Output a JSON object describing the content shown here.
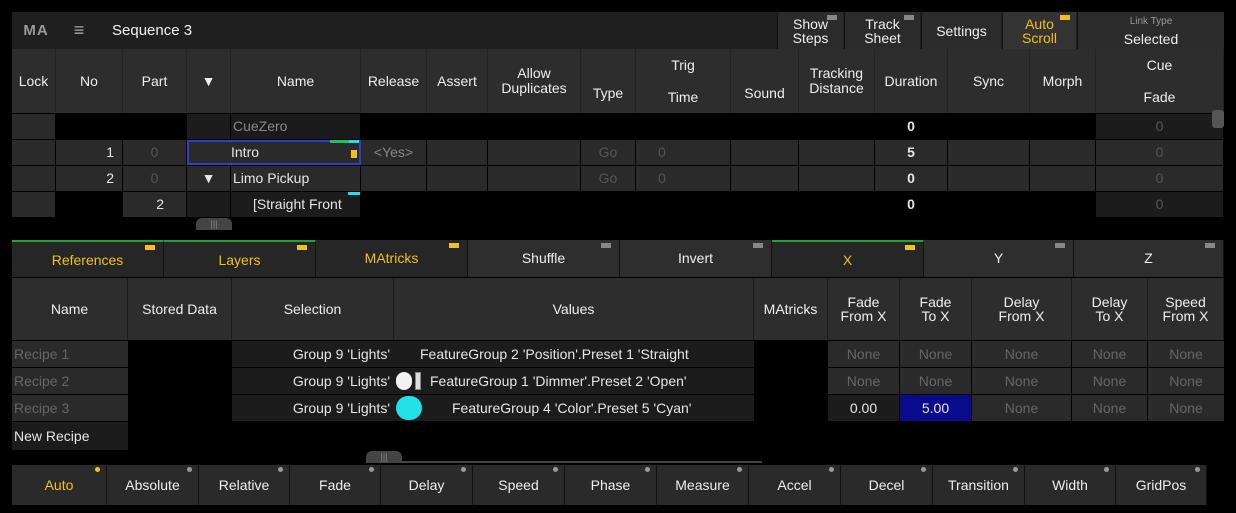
{
  "title_bar": {
    "logo": "MA",
    "menu_icon": "≡",
    "sequence": "Sequence 3",
    "buttons": [
      {
        "label": "Show Steps"
      },
      {
        "label": "Track Sheet"
      },
      {
        "label": "Settings"
      },
      {
        "label": "Auto Scroll",
        "active": true
      },
      {
        "label": "Link Type",
        "value": "Selected"
      }
    ]
  },
  "cue_columns": [
    "Lock",
    "No",
    "Part",
    "▼",
    "Name",
    "Release",
    "Assert",
    "Allow Duplicates",
    "Type",
    "Trig Time",
    "Sound",
    "Tracking Distance",
    "Duration",
    "Sync",
    "Morph",
    "Cue Fade"
  ],
  "cue_columns_split": {
    "trig1": "Trig",
    "trig2": "Time",
    "cue1": "Cue",
    "cue2": "Fade",
    "allow1": "Allow",
    "allow2": "Duplicates",
    "track1": "Tracking",
    "track2": "Distance",
    "type": "Type"
  },
  "cues": [
    {
      "no": "",
      "part": "",
      "arrow": "",
      "name": "CueZero",
      "release": "",
      "type": "",
      "trig": "",
      "duration": "0",
      "fade": "0"
    },
    {
      "no": "1",
      "part": "0",
      "arrow": "",
      "name": "Intro",
      "release": "<Yes>",
      "type": "Go",
      "trig": "0",
      "duration": "5",
      "fade": "0"
    },
    {
      "no": "2",
      "part": "0",
      "arrow": "▼",
      "name": "Limo  Pickup",
      "release": "",
      "type": "Go",
      "trig": "0",
      "duration": "0",
      "fade": "0"
    },
    {
      "no": "",
      "part": "2",
      "arrow": "",
      "name": "[Straight  Front",
      "release": "",
      "type": "",
      "trig": "",
      "duration": "0",
      "fade": "0"
    }
  ],
  "tabs": [
    {
      "label": "References",
      "active": true
    },
    {
      "label": "Layers",
      "active": true
    },
    {
      "label": "MAtricks",
      "active": true
    },
    {
      "label": "Shuffle"
    },
    {
      "label": "Invert"
    },
    {
      "label": "X",
      "active": true
    },
    {
      "label": "Y"
    },
    {
      "label": "Z"
    }
  ],
  "recipe_columns": {
    "name": "Name",
    "stored": "Stored Data",
    "selection": "Selection",
    "values": "Values",
    "matricks": "MAtricks",
    "fadefrom1": "Fade",
    "fadefrom2": "From X",
    "fadeto1": "Fade",
    "fadeto2": "To X",
    "delayfrom1": "Delay",
    "delayfrom2": "From X",
    "delayto1": "Delay",
    "delayto2": "To X",
    "speedfrom1": "Speed",
    "speedfrom2": "From X"
  },
  "recipes": [
    {
      "name": "Recipe 1",
      "selection": "Group 9 'Lights'",
      "values": "FeatureGroup 2 'Position'.Preset 1 'Straight",
      "fade_from": "None",
      "fade_to": "None",
      "delay_from": "None",
      "delay_to": "None",
      "speed_from": "None"
    },
    {
      "name": "Recipe 2",
      "selection": "Group 9 'Lights'",
      "values": "FeatureGroup 1 'Dimmer'.Preset 2 'Open'",
      "fade_from": "None",
      "fade_to": "None",
      "delay_from": "None",
      "delay_to": "None",
      "speed_from": "None"
    },
    {
      "name": "Recipe 3",
      "selection": "Group 9 'Lights'",
      "values": "FeatureGroup 4 'Color'.Preset 5 'Cyan'",
      "fade_from": "0.00",
      "fade_to": "5.00",
      "delay_from": "None",
      "delay_to": "None",
      "speed_from": "None"
    }
  ],
  "new_recipe": "New Recipe",
  "bottom_buttons": [
    {
      "label": "Auto",
      "active": true
    },
    {
      "label": "Absolute"
    },
    {
      "label": "Relative"
    },
    {
      "label": "Fade"
    },
    {
      "label": "Delay"
    },
    {
      "label": "Speed"
    },
    {
      "label": "Phase"
    },
    {
      "label": "Measure"
    },
    {
      "label": "Accel"
    },
    {
      "label": "Decel"
    },
    {
      "label": "Transition"
    },
    {
      "label": "Width"
    },
    {
      "label": "GridPos"
    }
  ],
  "colors": {
    "accent": "#f0c020",
    "selected_value": "#0a0a8c",
    "cyan_swatch": "#22e0e8"
  }
}
